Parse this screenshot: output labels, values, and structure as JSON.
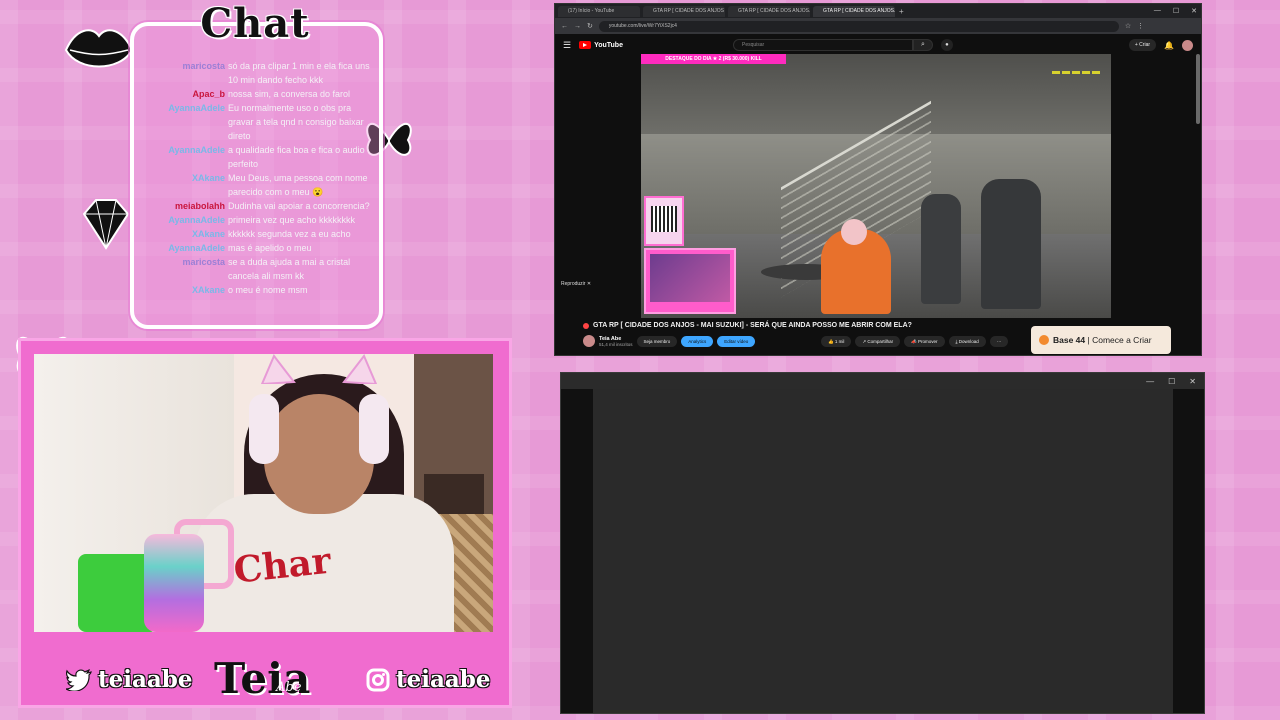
{
  "chat": {
    "title": "Chat",
    "messages": [
      {
        "user": "maricosta",
        "text": "só da pra clipar 1 min e ela fica uns 10 min dando fecho kkk",
        "color": "#9b7fd6"
      },
      {
        "user": "Apac_b",
        "text": "nossa sim, a conversa do farol",
        "color": "#c9163e"
      },
      {
        "user": "AyannaAdele",
        "text": "Eu normalmente uso o obs pra gravar a tela qnd n consigo baixar direto",
        "color": "#7ab8e8"
      },
      {
        "user": "AyannaAdele",
        "text": "a qualidade fica boa e fica o audio perfeito",
        "color": "#7ab8e8"
      },
      {
        "user": "XAkane",
        "text": "Meu Deus, uma pessoa com nome parecido com o meu 😮",
        "color": "#7ab8e8"
      },
      {
        "user": "meiabolahh",
        "text": "Dudinha vai apoiar a concorrencia?",
        "color": "#c9163e"
      },
      {
        "user": "AyannaAdele",
        "text": "primeira vez que acho kkkkkkkk",
        "color": "#7ab8e8"
      },
      {
        "user": "XAkane",
        "text": "kkkkkk segunda vez a eu acho",
        "color": "#7ab8e8"
      },
      {
        "user": "AyannaAdele",
        "text": "mas é apelido o meu",
        "color": "#7ab8e8"
      },
      {
        "user": "maricosta",
        "text": "se a duda ajuda a mai a cristal cancela ali msm kk",
        "color": "#9b7fd6"
      },
      {
        "user": "XAkane",
        "text": "o meu é nome msm",
        "color": "#7ab8e8"
      }
    ]
  },
  "webcam": {
    "shirt_print": "Char"
  },
  "branding": {
    "twitter_handle": "teiaabe",
    "instagram_handle": "teiaabe",
    "logo": "Teia",
    "logo_sub": "Abe"
  },
  "browser": {
    "tabs": [
      {
        "label": "(17) Início - YouTube",
        "active": false
      },
      {
        "label": "GTA RP [ CIDADE DOS ANJOS - MAI S...",
        "active": false
      },
      {
        "label": "GTA RP [ CIDADE DOS ANJOS...",
        "active": false
      },
      {
        "label": "GTA RP [ CIDADE DOS ANJOS...",
        "active": true
      }
    ],
    "url": "youtube.com/live/Wr7YiXS2jc4",
    "youtube": {
      "logo_text": "YouTube",
      "search_placeholder": "Pesquisar",
      "create_label": "+ Criar",
      "video": {
        "banner": "DESTAQUE DO DIA ★ 2 (R$ 30.000) KILL",
        "reproducao_label": "Reproduzir ✕",
        "title": "GTA RP [ CIDADE DOS ANJOS - MAI SUZUKI] - SERÁ QUE AINDA POSSO ME ABRIR COM ELA?",
        "channel": "Teia Abe",
        "subs": "51,4 mil inscritos",
        "buttons": {
          "join": "Seja membro",
          "analytics": "Analytics",
          "edit": "Editar vídeo",
          "likes": "1 mil",
          "share": "Compartilhar",
          "promote": "Promover",
          "download": "Download",
          "more": "⋯"
        }
      },
      "ad": {
        "brand": "Base 44",
        "cta": "Comece a Criar"
      }
    }
  },
  "dark_window": {
    "minimize": "—",
    "maximize": "☐",
    "close": "✕"
  },
  "colors": {
    "background": "#e79ad6",
    "accent_pink": "#ff2bbf",
    "frame_pink": "#f06ccf",
    "youtube_red": "#ff0000"
  }
}
